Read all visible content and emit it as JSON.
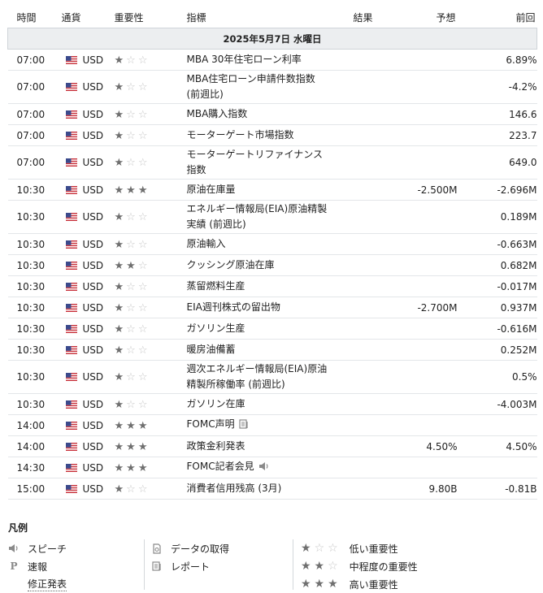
{
  "headers": {
    "time": "時間",
    "currency": "通貨",
    "importance": "重要性",
    "event": "指標",
    "actual": "結果",
    "forecast": "予想",
    "previous": "前回"
  },
  "date_label": "2025年5月7日 水曜日",
  "rows": [
    {
      "time": "07:00",
      "cur": "USD",
      "stars": 1,
      "event": "MBA 30年住宅ローン利率",
      "event2": "",
      "actual": "",
      "forecast": "",
      "previous": "6.89%"
    },
    {
      "time": "07:00",
      "cur": "USD",
      "stars": 1,
      "event": "MBA住宅ローン申請件数指数",
      "event2": "(前週比)",
      "actual": "",
      "forecast": "",
      "previous": "-4.2%"
    },
    {
      "time": "07:00",
      "cur": "USD",
      "stars": 1,
      "event": "MBA購入指数",
      "event2": "",
      "actual": "",
      "forecast": "",
      "previous": "146.6"
    },
    {
      "time": "07:00",
      "cur": "USD",
      "stars": 1,
      "event": "モーターゲート市場指数",
      "event2": "",
      "actual": "",
      "forecast": "",
      "previous": "223.7"
    },
    {
      "time": "07:00",
      "cur": "USD",
      "stars": 1,
      "event": "モーターゲートリファイナンス",
      "event2": "指数",
      "actual": "",
      "forecast": "",
      "previous": "649.0"
    },
    {
      "time": "10:30",
      "cur": "USD",
      "stars": 3,
      "event": "原油在庫量",
      "event2": "",
      "actual": "",
      "forecast": "-2.500M",
      "previous": "-2.696M"
    },
    {
      "time": "10:30",
      "cur": "USD",
      "stars": 1,
      "event": "エネルギー情報局(EIA)原油精製",
      "event2": "実績 (前週比)",
      "actual": "",
      "forecast": "",
      "previous": "0.189M"
    },
    {
      "time": "10:30",
      "cur": "USD",
      "stars": 1,
      "event": "原油輸入",
      "event2": "",
      "actual": "",
      "forecast": "",
      "previous": "-0.663M"
    },
    {
      "time": "10:30",
      "cur": "USD",
      "stars": 2,
      "event": "クッシング原油在庫",
      "event2": "",
      "actual": "",
      "forecast": "",
      "previous": "0.682M"
    },
    {
      "time": "10:30",
      "cur": "USD",
      "stars": 1,
      "event": "蒸留燃料生産",
      "event2": "",
      "actual": "",
      "forecast": "",
      "previous": "-0.017M"
    },
    {
      "time": "10:30",
      "cur": "USD",
      "stars": 1,
      "event": "EIA週刊株式の留出物",
      "event2": "",
      "actual": "",
      "forecast": "-2.700M",
      "previous": "0.937M"
    },
    {
      "time": "10:30",
      "cur": "USD",
      "stars": 1,
      "event": "ガソリン生産",
      "event2": "",
      "actual": "",
      "forecast": "",
      "previous": "-0.616M"
    },
    {
      "time": "10:30",
      "cur": "USD",
      "stars": 1,
      "event": "暖房油備蓄",
      "event2": "",
      "actual": "",
      "forecast": "",
      "previous": "0.252M"
    },
    {
      "time": "10:30",
      "cur": "USD",
      "stars": 1,
      "event": "週次エネルギー情報局(EIA)原油",
      "event2": "精製所稼働率 (前週比)",
      "actual": "",
      "forecast": "",
      "previous": "0.5%"
    },
    {
      "time": "10:30",
      "cur": "USD",
      "stars": 1,
      "event": "ガソリン在庫",
      "event2": "",
      "actual": "",
      "forecast": "",
      "previous": "-4.003M"
    },
    {
      "time": "14:00",
      "cur": "USD",
      "stars": 3,
      "event": "FOMC声明",
      "event2": "",
      "icon": "report-icon",
      "actual": "",
      "forecast": "",
      "previous": ""
    },
    {
      "time": "14:00",
      "cur": "USD",
      "stars": 3,
      "event": "政策金利発表",
      "event2": "",
      "actual": "",
      "forecast": "4.50%",
      "previous": "4.50%"
    },
    {
      "time": "14:30",
      "cur": "USD",
      "stars": 3,
      "event": "FOMC記者会見",
      "event2": "",
      "icon": "speech-icon",
      "actual": "",
      "forecast": "",
      "previous": ""
    },
    {
      "time": "15:00",
      "cur": "USD",
      "stars": 1,
      "event": "消費者信用残高 (3月)",
      "event2": "",
      "actual": "",
      "forecast": "9.80B",
      "previous": "-0.81B"
    }
  ],
  "legend": {
    "title": "凡例",
    "speech": "スピーチ",
    "prelim_symbol": "P",
    "prelim": "速報",
    "revised": "修正発表",
    "retrieve": "データの取得",
    "report": "レポート",
    "low": "低い重要性",
    "medium": "中程度の重要性",
    "high": "高い重要性"
  },
  "colors": {
    "star_on": "#6f6f6f",
    "star_off": "#c7c7c7",
    "date_bg": "#eceef0"
  }
}
